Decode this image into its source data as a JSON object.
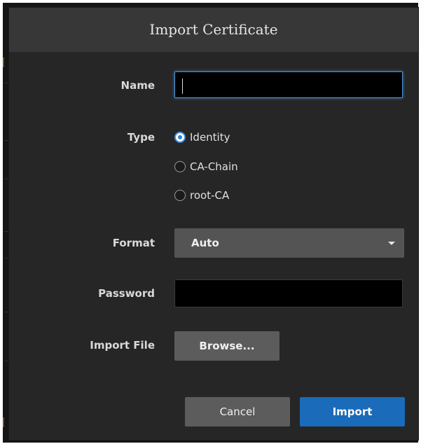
{
  "dialog": {
    "title": "Import Certificate"
  },
  "form": {
    "name": {
      "label": "Name",
      "value": ""
    },
    "type": {
      "label": "Type",
      "selected": "Identity",
      "options": [
        {
          "label": "Identity",
          "checked": true
        },
        {
          "label": "CA-Chain",
          "checked": false
        },
        {
          "label": "root-CA",
          "checked": false
        }
      ]
    },
    "format": {
      "label": "Format",
      "value": "Auto"
    },
    "password": {
      "label": "Password",
      "value": ""
    },
    "import_file": {
      "label": "Import File",
      "browse_label": "Browse..."
    }
  },
  "footer": {
    "cancel_label": "Cancel",
    "import_label": "Import"
  },
  "colors": {
    "dialog_bg": "#262626",
    "header_bg": "#373737",
    "input_bg": "#000000",
    "focus_border": "#4a8fd8",
    "primary_button": "#1a6bb9",
    "secondary_button": "#5c5c5c",
    "radio_accent": "#2f7fd6"
  },
  "icons": {
    "format_dropdown": "chevron-down-icon",
    "radio_selected": "radio-checked-icon",
    "radio_unselected": "radio-unchecked-icon"
  }
}
